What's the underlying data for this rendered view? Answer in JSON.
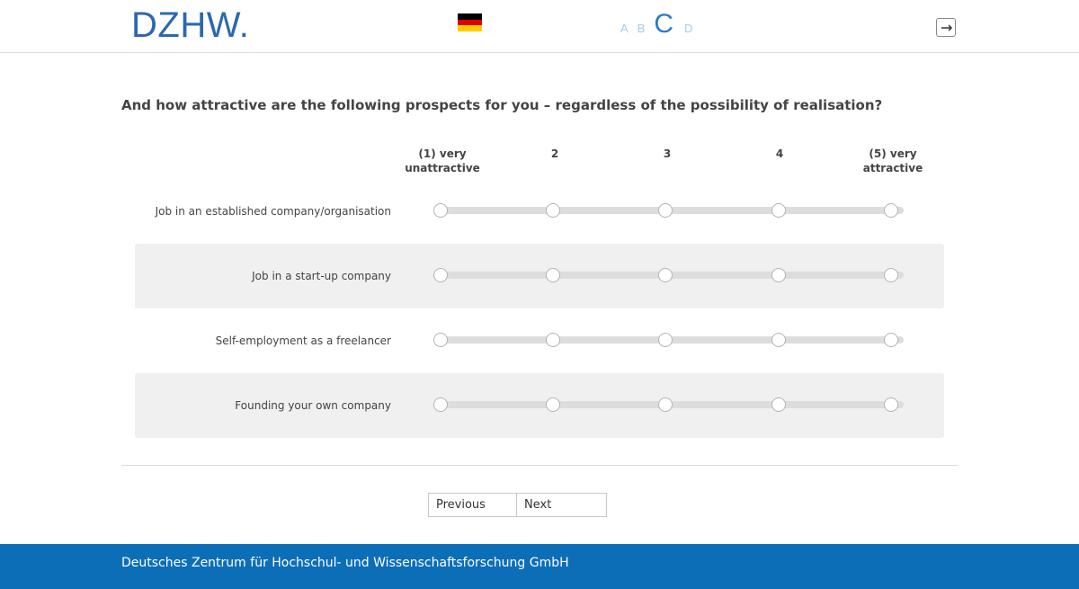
{
  "header": {
    "logo_text": "DZHW.",
    "language_flag": "german-flag",
    "font_sizes": [
      "A",
      "B",
      "C",
      "D"
    ],
    "active_font_size": "C",
    "logout_icon": "logout-icon"
  },
  "question": {
    "text": "And how attractive are the following prospects for you – regardless of the possibility of realisation?"
  },
  "scale": {
    "labels": [
      "(1) very unattractive",
      "2",
      "3",
      "4",
      "(5) very attractive"
    ]
  },
  "items": [
    {
      "label": "Job in an established company/organisation",
      "selected": null
    },
    {
      "label": "Job in a start-up company",
      "selected": null
    },
    {
      "label": "Self-employment as a freelancer",
      "selected": null
    },
    {
      "label": "Founding your own company",
      "selected": null
    }
  ],
  "navigation": {
    "previous_label": "Previous",
    "next_label": "Next"
  },
  "footer": {
    "text": "Deutsches Zentrum für Hochschul- und Wissenschaftsforschung GmbH"
  },
  "colors": {
    "brand_blue": "#2d68ae",
    "footer_blue": "#0d6eb8",
    "row_shade": "#f0f0f0",
    "track": "#dddddd"
  }
}
